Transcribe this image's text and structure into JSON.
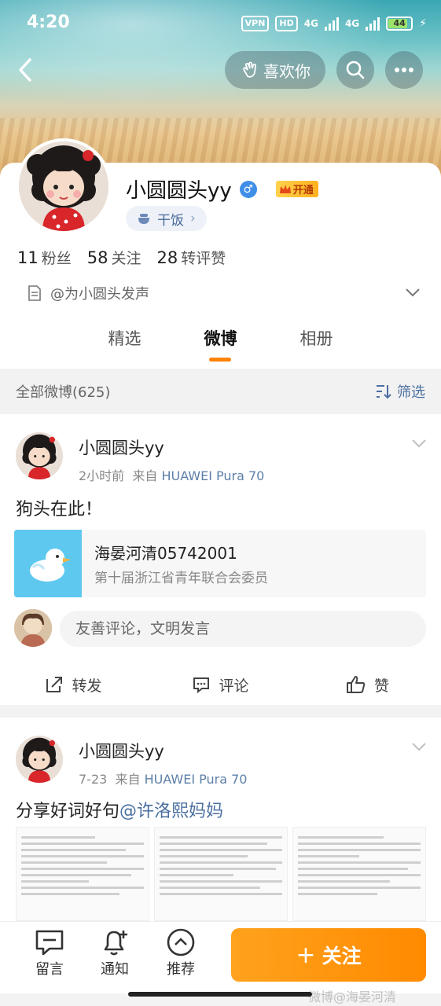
{
  "status_bar": {
    "time": "4:20",
    "vpn": "VPN",
    "hd": "HD",
    "net1": "4G",
    "net2": "4G",
    "battery": "44"
  },
  "header": {
    "like_label": "喜欢你"
  },
  "profile": {
    "name": "小圆圆头yy",
    "vip_label": "开通",
    "tag": "干饭",
    "stats": [
      {
        "value": "11",
        "label": "粉丝"
      },
      {
        "value": "58",
        "label": "关注"
      },
      {
        "value": "28",
        "label": "转评赞"
      }
    ],
    "intro": "@为小圆头发声"
  },
  "tabs": [
    {
      "label": "精选",
      "active": false
    },
    {
      "label": "微博",
      "active": true
    },
    {
      "label": "相册",
      "active": false
    }
  ],
  "filter": {
    "all_label": "全部微博(625)",
    "filter_label": "筛选"
  },
  "posts": [
    {
      "author": "小圆圆头yy",
      "time": "2小时前",
      "source_prefix": "来自",
      "device": "HUAWEI Pura 70",
      "text": "狗头在此！",
      "link_card": {
        "title": "海晏河清05742001",
        "subtitle": "第十届浙江省青年联合会委员"
      },
      "comment_placeholder": "友善评论，文明发言",
      "actions": {
        "repost": "转发",
        "comment": "评论",
        "like": "赞"
      }
    },
    {
      "author": "小圆圆头yy",
      "time": "7-23",
      "source_prefix": "来自",
      "device": "HUAWEI Pura 70",
      "text": "分享好词好句",
      "mention": "@许洛熙妈妈"
    }
  ],
  "bottom_bar": {
    "message": "留言",
    "notify": "通知",
    "recommend": "推荐",
    "follow": "关注"
  },
  "watermark": "微博@海晏河清05742001",
  "colors": {
    "accent": "#ff8200",
    "link": "#4a6fa0",
    "follow_btn": "#ff9a0e"
  }
}
